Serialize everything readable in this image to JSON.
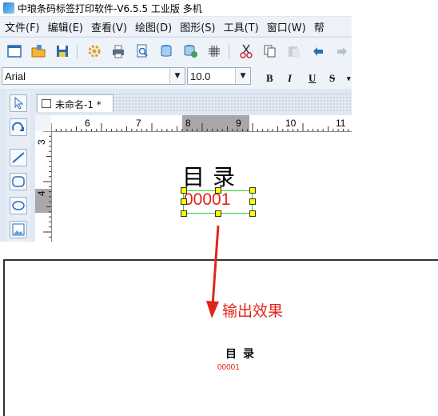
{
  "window": {
    "title": "中琅条码标签打印软件-V6.5.5 工业版 多机"
  },
  "menu": [
    "文件(F)",
    "编辑(E)",
    "查看(V)",
    "绘图(D)",
    "图形(S)",
    "工具(T)",
    "窗口(W)",
    "帮"
  ],
  "toolbar": {
    "icons": [
      "new-icon",
      "open-icon",
      "save-icon",
      "settings-icon",
      "print-icon",
      "print-preview-icon",
      "database-icon",
      "database-link-icon",
      "grid-icon",
      "cut-icon",
      "copy-icon",
      "paste-icon",
      "undo-icon",
      "redo-icon"
    ]
  },
  "fontbar": {
    "font_name": "Arial",
    "font_size": "10.0",
    "bold": "B",
    "italic": "I",
    "underline": "U",
    "strike": "S"
  },
  "document": {
    "tab_label": "未命名-1 *"
  },
  "ruler": {
    "h_ticks": [
      "6",
      "7",
      "8",
      "9",
      "10",
      "11"
    ],
    "v_ticks": [
      "3",
      "4"
    ]
  },
  "label": {
    "heading": "目录",
    "code": "00001"
  },
  "annotation": {
    "text": "输出效果"
  },
  "preview": {
    "heading": "目录",
    "code": "00001"
  },
  "colors": {
    "accent_red": "#e0261b",
    "selection_green": "#2ccf2c",
    "handle_yellow": "#ffff00"
  }
}
